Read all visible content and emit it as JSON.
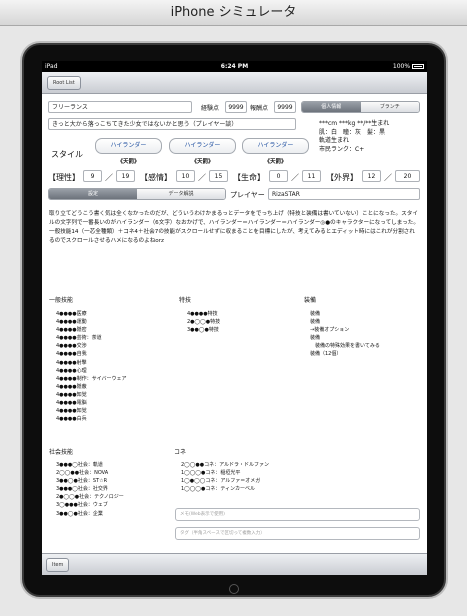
{
  "simulator": {
    "title": "iPhone シミュレータ"
  },
  "statusbar": {
    "carrier": "iPad",
    "time": "6:24 PM",
    "battery": "100%"
  },
  "nav": {
    "back_label": "Root List"
  },
  "profile": {
    "name": "フリーランス",
    "exp_label": "経験点",
    "exp_value": "9999",
    "reward_label": "報酬点",
    "reward_value": "9999",
    "tabs": [
      "個人情報",
      "ブランチ"
    ],
    "quote": "きっと大から落っこちてきた少女ではないかと思う（プレイヤー談）",
    "info_lines": [
      "***cm ***kg **/**生まれ",
      "肌：白　瞳：灰　髪：黒",
      "軌道生まれ",
      "市民ランク：C+"
    ]
  },
  "style": {
    "label": "スタイル",
    "buttons": [
      "ハイランダー",
      "ハイランダー",
      "ハイランダー"
    ],
    "subs": [
      "《天罰》",
      "《天罰》",
      "《天罰》"
    ]
  },
  "stats": [
    {
      "name": "【理性】",
      "cur": "9",
      "max": "19"
    },
    {
      "name": "【感情】",
      "cur": "10",
      "max": "15"
    },
    {
      "name": "【生命】",
      "cur": "0",
      "max": "11"
    },
    {
      "name": "【外界】",
      "cur": "12",
      "max": "20"
    }
  ],
  "stat_sep": "／",
  "mode": {
    "tabs": [
      "設定",
      "データ解説"
    ],
    "player_label": "プレイヤー",
    "player_value": "RizaSTAR"
  },
  "description": "取り立てどうこう書く気は全くなかったのだが、どういうわけかまるっとデータをでっち上げ（特技と装備は書いていない）ことになった。スタイルの文字列で一番長いのがハイランダー（6文字）なおかげで、ハイランダー＝ハイランダー＝ハイランダー◎●のキャラクターになってしまった。\n一般技能14（一芯全種類）＋コネ4＋社会7の技能がスクロールせずに収まることを目標にしたが、考えてみるとエディット時にはこれが分割されるのでスクロールさせるハメになるのよねorz",
  "sections": {
    "general": {
      "title": "一般技能",
      "items": [
        "4●●●●医療",
        "4●●●●運動",
        "4●●●●隠密",
        "4●●●●芸術：茶道",
        "4●●●●交渉",
        "4●●●●自我",
        "4●●●●射撃",
        "4●●●●心理",
        "4●●●●制作：サイバーウェア",
        "4●●●●隠蔽",
        "4●●●●知覚",
        "4●●●●電脳",
        "4●●●●知覚",
        "4●●●●白兵"
      ]
    },
    "special": {
      "title": "特技",
      "items": [
        "4●●●●特技",
        "2●◯◯●特技",
        "3●●◯●特技"
      ]
    },
    "equip": {
      "title": "装備",
      "items": [
        "装備",
        "装備",
        "→装備オプション",
        "装備",
        "　装備の特殊効果を書いてみる",
        "装備（12個）"
      ]
    },
    "social": {
      "title": "社会技能",
      "items": [
        "3●●●◯社会：軌道",
        "2◯◯●●社会：NOVA",
        "3●●◯●社会：ST☆R",
        "3●●●◯社会：社交界",
        "2●◯◯●社会：テクノロジー",
        "3◯●●●社会：ウェブ",
        "3●●◯●社会：企業"
      ]
    },
    "kone": {
      "title": "コネ",
      "items": [
        "2◯◯●●コネ：アルドラ・ドルファン",
        "1◯◯◯●コネ：稲垣光平",
        "1◯●◯◯コネ：アルファ＝オメガ",
        "1◯◯◯●コネ：ティンカーベル"
      ]
    }
  },
  "memo": {
    "placeholder": "メモ(Web表示で使用)",
    "tag_placeholder": "タグ（半角スペースで区切って複数入力）"
  },
  "toolbar": {
    "button_label": "Item"
  }
}
